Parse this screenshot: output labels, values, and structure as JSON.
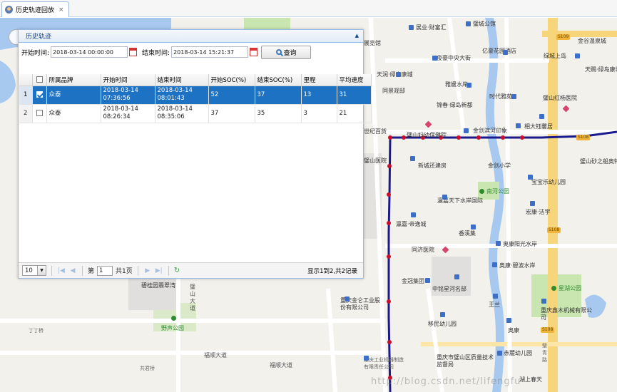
{
  "tab": {
    "label": "历史轨迹回放",
    "close": "×"
  },
  "panel": {
    "title": "历史轨迹",
    "start_label": "开始时间:",
    "start_value": "2018-03-14 00:00:00",
    "end_label": "结束时间:",
    "end_value": "2018-03-14 15:21:37",
    "query_label": "查询"
  },
  "grid": {
    "columns": [
      "所属品牌",
      "开始时间",
      "结束时间",
      "开始SOC(%)",
      "结束SOC(%)",
      "里程",
      "平均速度"
    ],
    "rows": [
      {
        "num": "1",
        "brand": "众泰",
        "start_date": "2018-03-14",
        "start_time": "07:36:56",
        "end_date": "2018-03-14",
        "end_time": "08:01:43",
        "start_soc": "52",
        "end_soc": "37",
        "mileage": "13",
        "avg_speed": "31",
        "selected": true
      },
      {
        "num": "2",
        "brand": "众泰",
        "start_date": "2018-03-14",
        "start_time": "08:26:34",
        "end_date": "2018-03-14",
        "end_time": "08:35:06",
        "start_soc": "37",
        "end_soc": "35",
        "mileage": "3",
        "avg_speed": "21",
        "selected": false
      }
    ]
  },
  "pager": {
    "page_size": "10",
    "page_prefix": "第",
    "page_value": "1",
    "page_suffix": "共1页",
    "info": "显示1到2,共2记录"
  },
  "map": {
    "labels": {
      "l1": "展览馆",
      "l2": "展业·财富汇",
      "l3": "璧城公馆",
      "l4": "俊豪中央大街",
      "l5": "亿豪花园酒店",
      "l6": "天润·绿岛康城",
      "l7": "雅媛水岸",
      "l8": "同景观邸",
      "l9": "锦春·绿岛新都",
      "l10": "时代雅苑",
      "l11": "璧山红杨医院",
      "l12": "相大钰馨居",
      "l13": "世纪百货",
      "l14": "璧山妇幼保健院",
      "l15": "金剑滨河印象",
      "l16": "璧山医院",
      "l17": "新城还建房",
      "l18": "金剑小学",
      "l19": "南河公园",
      "l20": "宝宝乐幼儿园",
      "l21": "瀛嘉天下水岸国际",
      "l22": "宏康·洁宇",
      "l23": "瀛嘉·帝逸城",
      "l24": "香溪集",
      "l25": "奥康阳光水岸",
      "l26": "同济医院",
      "l27": "奥康·碧波水岸",
      "l28": "金冠集团",
      "l29": "中铭星河名邸",
      "l30": "星湖公园",
      "l31": "碧桂园翡翠湾",
      "l32": "重庆金仑工业股份有限公司",
      "l33": "王兰",
      "l34": "重庆鑫木机械有限公司",
      "l35": "野声公园",
      "l36": "移民幼儿园",
      "l37": "奥康",
      "l38": "重庆市璧山区质量技术监督局",
      "l39": "赤麓幼儿园",
      "l40": "丁丁桥",
      "l41": "福顺大道",
      "l42": "共君桥",
      "l43": "璧山砂之船奥特莱斯",
      "l44": "天赐·绿岛康城温泉度假",
      "l45": "金谷温泉城",
      "l46": "湿地公园",
      "l47": "绿城上岛",
      "l48": "雷公",
      "l49": "璧青路",
      "l50": "重庆工业机器制造有限责任公司",
      "l51": "湖上春天",
      "l52": "福顺大道",
      "l53": "璧山大道"
    },
    "shields": {
      "s1": "S108",
      "s2": "S108",
      "s3": "S108",
      "s4": "S109"
    },
    "watermark": "http://blog.csdn.net/lifengfu"
  },
  "colors": {
    "selected_row": "#1e72c4",
    "track_line": "#1a1a8c",
    "track_point": "#c8102e",
    "panel_border": "#99bbe8"
  }
}
